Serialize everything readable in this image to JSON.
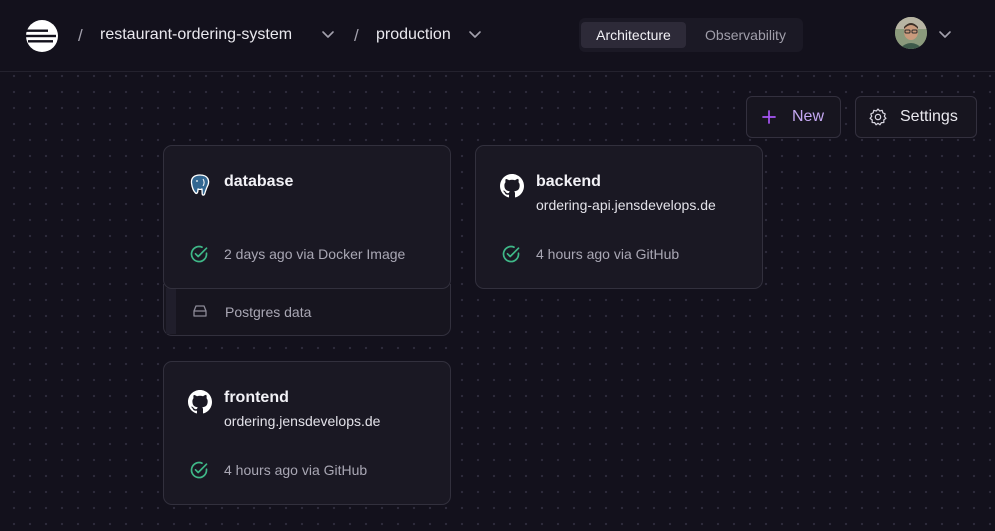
{
  "header": {
    "project": "restaurant-ordering-system",
    "environment": "production",
    "separator": "/",
    "tabs": [
      {
        "label": "Architecture",
        "active": true
      },
      {
        "label": "Observability",
        "active": false
      }
    ]
  },
  "toolbar": {
    "new_label": "New",
    "settings_label": "Settings"
  },
  "services": {
    "database": {
      "name": "database",
      "status": "2 days ago via Docker Image",
      "icon": "postgres-icon"
    },
    "backend": {
      "name": "backend",
      "url": "ordering-api.jensdevelops.de",
      "status": "4 hours ago via GitHub",
      "icon": "github-icon"
    },
    "frontend": {
      "name": "frontend",
      "url": "ordering.jensdevelops.de",
      "status": "4 hours ago via GitHub",
      "icon": "github-icon"
    }
  },
  "volume": {
    "label": "Postgres data",
    "icon": "drive-icon"
  },
  "colors": {
    "background": "#13111c",
    "card": "#1a1823",
    "accent": "#a855f7",
    "success": "#3fb888"
  }
}
